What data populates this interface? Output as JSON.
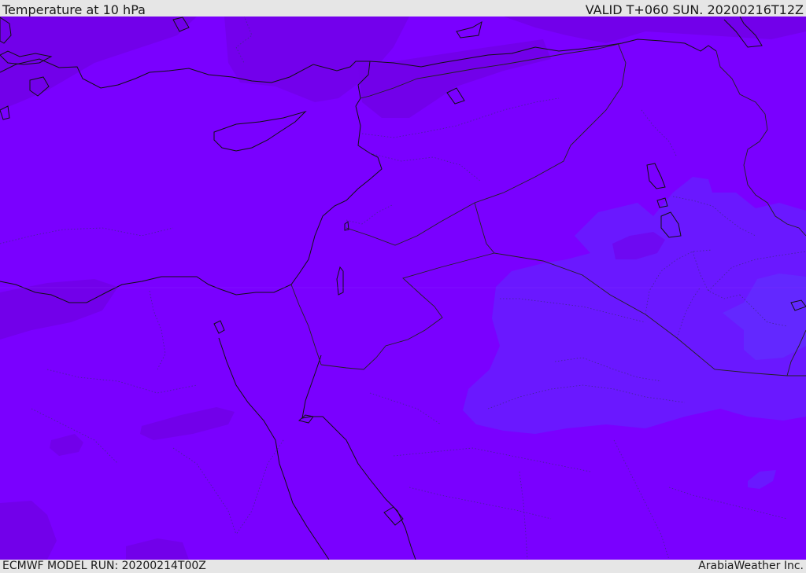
{
  "header": {
    "title": "Temperature at 10 hPa",
    "valid_time": "VALID T+060 SUN. 20200216T12Z"
  },
  "footer": {
    "model_run": "ECMWF MODEL RUN: 20200214T00Z",
    "credit": "ArabiaWeather Inc."
  },
  "map": {
    "field": "Temperature at 10 hPa",
    "colors": {
      "base": "#7a00ff",
      "warm_patch": "#7200ea",
      "cool_patch": "#6a18ff",
      "cooler_patch": "#6328ff",
      "coastline": "#111111",
      "border": "#222222"
    }
  }
}
